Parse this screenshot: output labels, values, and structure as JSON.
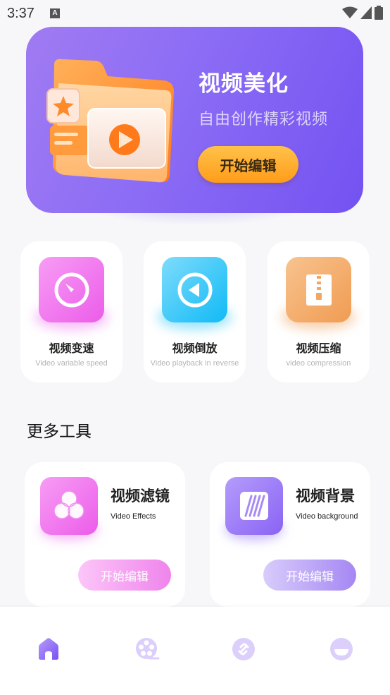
{
  "status_bar": {
    "time": "3:37",
    "notification_badge": "A"
  },
  "hero": {
    "title": "视频美化",
    "subtitle": "自由创作精彩视频",
    "button_label": "开始编辑"
  },
  "features": [
    {
      "title": "视频变速",
      "subtitle": "Video variable speed",
      "icon": "speedometer-icon"
    },
    {
      "title": "视频倒放",
      "subtitle": "Video playback in reverse",
      "icon": "rewind-icon"
    },
    {
      "title": "视频压缩",
      "subtitle": "video compression",
      "icon": "zip-file-icon"
    }
  ],
  "more_tools": {
    "section_title": "更多工具",
    "items": [
      {
        "title": "视频滤镜",
        "subtitle": "Video Effects",
        "button_label": "开始编辑",
        "icon": "filter-circles-icon"
      },
      {
        "title": "视频背景",
        "subtitle": "Video background",
        "button_label": "开始编辑",
        "icon": "background-stripes-icon"
      }
    ]
  },
  "bottom_nav": [
    {
      "name": "home",
      "icon": "home-icon",
      "active": true
    },
    {
      "name": "film",
      "icon": "film-reel-icon",
      "active": false
    },
    {
      "name": "link",
      "icon": "link-icon",
      "active": false
    },
    {
      "name": "profile",
      "icon": "profile-icon",
      "active": false
    }
  ],
  "colors": {
    "primary": "#7b5cf3",
    "accent_orange": "#ff9c1a",
    "pink": "#ee6bf0",
    "blue": "#22c3f7",
    "peach": "#f2a45f",
    "nav_inactive": "#d6cafb"
  }
}
